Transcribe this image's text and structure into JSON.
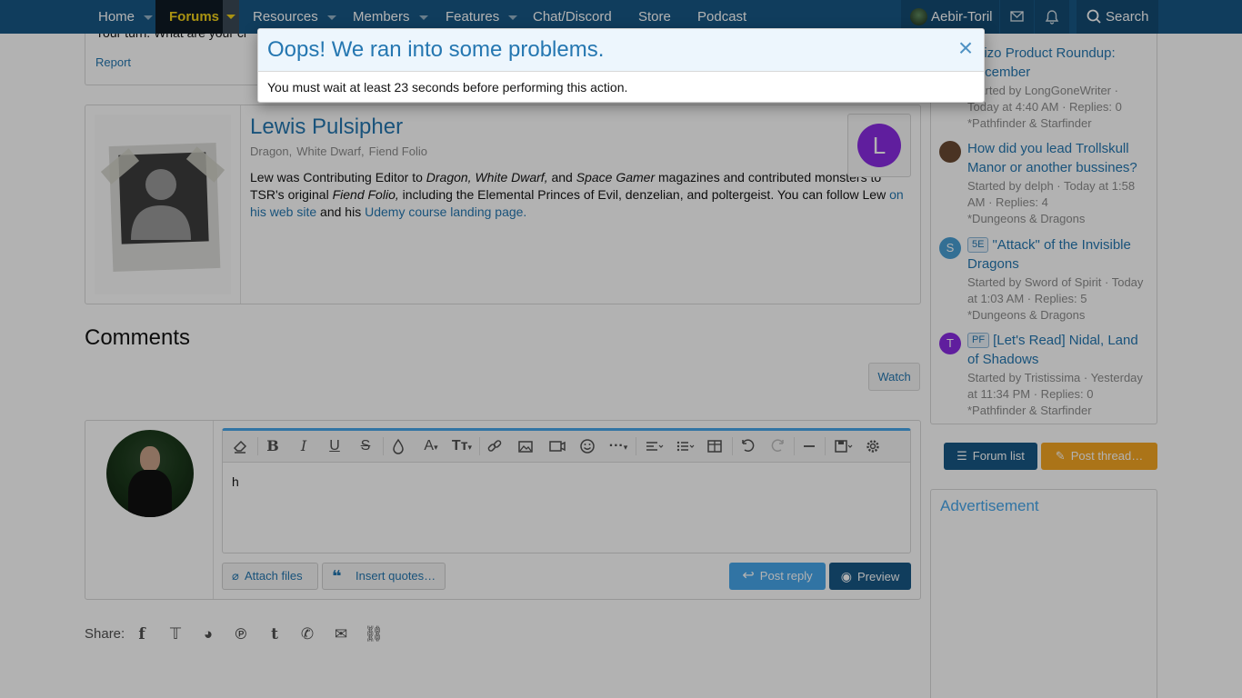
{
  "nav": {
    "home": "Home",
    "forums": "Forums",
    "resources": "Resources",
    "members": "Members",
    "features": "Features",
    "chat": "Chat/Discord",
    "store": "Store",
    "podcast": "Podcast",
    "username": "Aebir-Toril",
    "search": "Search"
  },
  "post": {
    "partial_text": "Your turn. What are your cl",
    "report": "Report"
  },
  "author": {
    "name": "Lewis Pulsipher",
    "tags": [
      "Dragon,",
      "White Dwarf,",
      "Fiend Folio"
    ],
    "badge_letter": "L",
    "bio": {
      "p1": "Lew was Contributing Editor to ",
      "dragon": "Dragon, White Dwarf,",
      "and1": " and ",
      "space": "Space Gamer",
      "p2": " magazines and contributed monsters to TSR's original ",
      "fiend": "Fiend Folio,",
      "p3": " including the Elemental Princes of Evil, denzelian, and poltergeist. You can follow Lew ",
      "link1": "on his web site",
      "p4": " and his ",
      "link2": "Udemy course landing page."
    }
  },
  "comments": {
    "title": "Comments",
    "watch": "Watch"
  },
  "editor": {
    "text": "h",
    "attach": "Attach files",
    "insert_quotes": "Insert quotes…",
    "post_reply": "Post reply",
    "preview": "Preview"
  },
  "share": {
    "label": "Share:"
  },
  "sidebar": {
    "threads": [
      {
        "avatar_letter": "",
        "prefix": "",
        "title": "Paizo Product Roundup: December",
        "meta": "Started by LongGoneWriter · Today at 4:40 AM · Replies: 0",
        "category": "*Pathfinder & Starfinder"
      },
      {
        "avatar_letter": "",
        "prefix": "",
        "title": "How did you lead Trollskull Manor or another bussines?",
        "meta": "Started by delph · Today at 1:58 AM · Replies: 4",
        "category": "*Dungeons & Dragons"
      },
      {
        "avatar_letter": "S",
        "prefix": "5E",
        "title": "\"Attack\" of the Invisible Dragons",
        "meta": "Started by Sword of Spirit · Today at 1:03 AM · Replies: 5",
        "category": "*Dungeons & Dragons"
      },
      {
        "avatar_letter": "T",
        "prefix": "PF",
        "title": "[Let's Read] Nidal, Land of Shadows",
        "meta": "Started by Tristissima · Yesterday at 11:34 PM · Replies: 0",
        "category": "*Pathfinder & Starfinder"
      }
    ],
    "forum_list": "Forum list",
    "post_thread": "Post thread…",
    "advertisement": "Advertisement"
  },
  "modal": {
    "title": "Oops! We ran into some problems.",
    "message": "You must wait at least 23 seconds before performing this action.",
    "close": "×"
  },
  "colors": {
    "nav_bg": "#185886",
    "link": "#2577b1",
    "forums_active": "#f2d21b",
    "primary_button": "#47a7eb",
    "preview_button": "#185886",
    "post_thread_button": "#f5a623",
    "avatar_S": "#4a9fd5",
    "avatar_T": "#8a2be2"
  }
}
